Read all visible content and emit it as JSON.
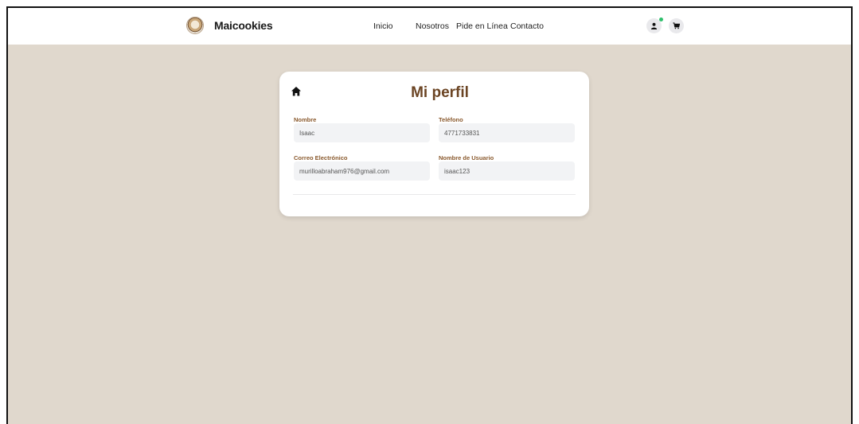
{
  "brand": {
    "name": "Maicookies",
    "logo_icon": "cookie-logo-icon"
  },
  "nav": {
    "links": [
      "Inicio",
      "Nosotros",
      "Pide en Línea",
      "Contacto"
    ]
  },
  "header_icons": {
    "user": "user-icon",
    "cart": "cart-icon",
    "status_color": "#2dbf6b"
  },
  "profile": {
    "title": "Mi perfil",
    "home_icon": "home-icon",
    "fields": {
      "nombre_label": "Nombre",
      "nombre_value": "Isaac",
      "telefono_label": "Teléfono",
      "telefono_value": "4771733831",
      "correo_label": "Correo Electrónico",
      "correo_value": "murilloabraham976@gmail.com",
      "usuario_label": "Nombre de Usuario",
      "usuario_value": "isaac123"
    }
  },
  "colors": {
    "background": "#e0d8cd",
    "title": "#6b4423",
    "label": "#8a5a2e"
  }
}
